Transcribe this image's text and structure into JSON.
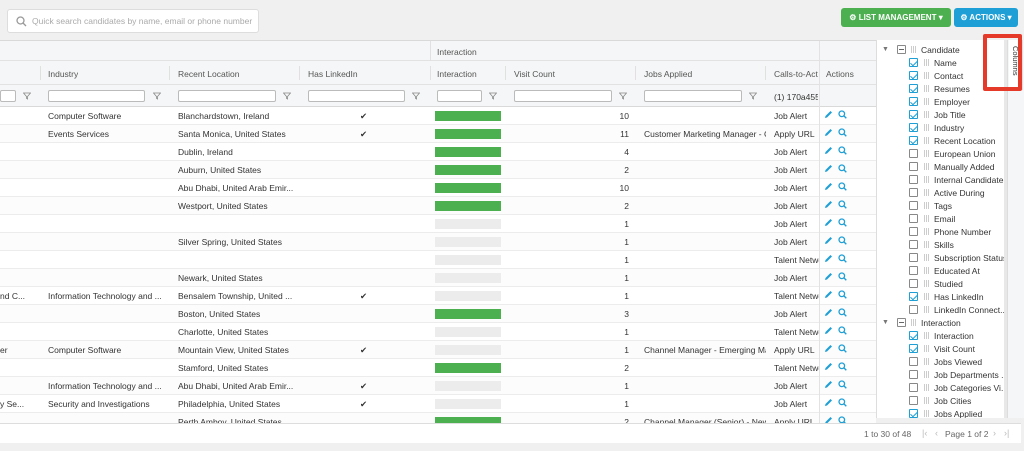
{
  "search": {
    "placeholder": "Quick search candidates by name, email or phone number"
  },
  "buttons": {
    "list_management": "LIST MANAGEMENT",
    "actions": "ACTIONS"
  },
  "colors": {
    "green": "#4caf50",
    "blue": "#1e9fd6",
    "highlight": "#e53a2a"
  },
  "grid": {
    "group_header": "Interaction",
    "headers": {
      "industry": "Industry",
      "recent_location": "Recent Location",
      "has_linkedin": "Has LinkedIn",
      "interaction": "Interaction",
      "visit_count": "Visit Count",
      "jobs_applied": "Jobs Applied",
      "calls_to_action": "Calls-to-Act",
      "actions": "Actions"
    },
    "filter_cta_text": "(1) 170a455",
    "rows": [
      {
        "first": "",
        "industry": "Computer Software",
        "location": "Blanchardstown, Ireland",
        "linkedin": "✔",
        "interaction": 1,
        "visits": "10",
        "jobs": "",
        "cta": "Job Alert"
      },
      {
        "first": "",
        "industry": "Events Services",
        "location": "Santa Monica, United States",
        "linkedin": "✔",
        "interaction": 1,
        "visits": "11",
        "jobs": "Customer Marketing Manager - C",
        "cta": "Apply URL"
      },
      {
        "first": "",
        "industry": "",
        "location": "Dublin, Ireland",
        "linkedin": "",
        "interaction": 1,
        "visits": "4",
        "jobs": "",
        "cta": "Job Alert"
      },
      {
        "first": "",
        "industry": "",
        "location": "Auburn, United States",
        "linkedin": "",
        "interaction": 1,
        "visits": "2",
        "jobs": "",
        "cta": "Job Alert"
      },
      {
        "first": "",
        "industry": "",
        "location": "Abu Dhabi, United Arab Emir...",
        "linkedin": "",
        "interaction": 1,
        "visits": "10",
        "jobs": "",
        "cta": "Job Alert"
      },
      {
        "first": "",
        "industry": "",
        "location": "Westport, United States",
        "linkedin": "",
        "interaction": 1,
        "visits": "2",
        "jobs": "",
        "cta": "Job Alert"
      },
      {
        "first": "",
        "industry": "",
        "location": "",
        "linkedin": "",
        "interaction": 0,
        "visits": "1",
        "jobs": "",
        "cta": "Job Alert"
      },
      {
        "first": "",
        "industry": "",
        "location": "Silver Spring, United States",
        "linkedin": "",
        "interaction": 0,
        "visits": "1",
        "jobs": "",
        "cta": "Job Alert"
      },
      {
        "first": "",
        "industry": "",
        "location": "",
        "linkedin": "",
        "interaction": 0,
        "visits": "1",
        "jobs": "",
        "cta": "Talent Netwo"
      },
      {
        "first": "",
        "industry": "",
        "location": "Newark, United States",
        "linkedin": "",
        "interaction": 0,
        "visits": "1",
        "jobs": "",
        "cta": "Job Alert"
      },
      {
        "first": "nd C...",
        "industry": "Information Technology and ...",
        "location": "Bensalem Township, United ...",
        "linkedin": "✔",
        "interaction": 0,
        "visits": "1",
        "jobs": "",
        "cta": "Talent Netwo"
      },
      {
        "first": "",
        "industry": "",
        "location": "Boston, United States",
        "linkedin": "",
        "interaction": 1,
        "visits": "3",
        "jobs": "",
        "cta": "Job Alert"
      },
      {
        "first": "",
        "industry": "",
        "location": "Charlotte, United States",
        "linkedin": "",
        "interaction": 0,
        "visits": "1",
        "jobs": "",
        "cta": "Talent Netwo"
      },
      {
        "first": "er",
        "industry": "Computer Software",
        "location": "Mountain View, United States",
        "linkedin": "✔",
        "interaction": 0,
        "visits": "1",
        "jobs": "Channel Manager - Emerging Ma",
        "cta": "Apply URL"
      },
      {
        "first": "",
        "industry": "",
        "location": "Stamford, United States",
        "linkedin": "",
        "interaction": 1,
        "visits": "2",
        "jobs": "",
        "cta": "Talent Netwo"
      },
      {
        "first": "",
        "industry": "Information Technology and ...",
        "location": "Abu Dhabi, United Arab Emir...",
        "linkedin": "✔",
        "interaction": 0,
        "visits": "1",
        "jobs": "",
        "cta": "Job Alert"
      },
      {
        "first": "y Se...",
        "industry": "Security and Investigations",
        "location": "Philadelphia, United States",
        "linkedin": "✔",
        "interaction": 0,
        "visits": "1",
        "jobs": "",
        "cta": "Job Alert"
      },
      {
        "first": "",
        "industry": "",
        "location": "Perth Amboy, United States",
        "linkedin": "",
        "interaction": 1,
        "visits": "2",
        "jobs": "Channel Manager (Senior) - New",
        "cta": "Apply URL"
      }
    ]
  },
  "footer": {
    "range": "1 to 30 of 48",
    "page": "Page 1 of 2"
  },
  "columns_tab": "Columns",
  "column_panel": [
    {
      "type": "group",
      "label": "Candidate"
    },
    {
      "type": "item",
      "label": "Name",
      "checked": true
    },
    {
      "type": "item",
      "label": "Contact",
      "checked": true
    },
    {
      "type": "item",
      "label": "Resumes",
      "checked": true
    },
    {
      "type": "item",
      "label": "Employer",
      "checked": true
    },
    {
      "type": "item",
      "label": "Job Title",
      "checked": true
    },
    {
      "type": "item",
      "label": "Industry",
      "checked": true
    },
    {
      "type": "item",
      "label": "Recent Location",
      "checked": true
    },
    {
      "type": "item",
      "label": "European Union",
      "checked": false
    },
    {
      "type": "item",
      "label": "Manually Added",
      "checked": false
    },
    {
      "type": "item",
      "label": "Internal Candidate",
      "checked": false
    },
    {
      "type": "item",
      "label": "Active During",
      "checked": false
    },
    {
      "type": "item",
      "label": "Tags",
      "checked": false
    },
    {
      "type": "item",
      "label": "Email",
      "checked": false
    },
    {
      "type": "item",
      "label": "Phone Number",
      "checked": false
    },
    {
      "type": "item",
      "label": "Skills",
      "checked": false
    },
    {
      "type": "item",
      "label": "Subscription Status",
      "checked": false
    },
    {
      "type": "item",
      "label": "Educated At",
      "checked": false
    },
    {
      "type": "item",
      "label": "Studied",
      "checked": false
    },
    {
      "type": "item",
      "label": "Has LinkedIn",
      "checked": true
    },
    {
      "type": "item",
      "label": "LinkedIn Connect...",
      "checked": false
    },
    {
      "type": "group",
      "label": "Interaction"
    },
    {
      "type": "item",
      "label": "Interaction",
      "checked": true
    },
    {
      "type": "item",
      "label": "Visit Count",
      "checked": true
    },
    {
      "type": "item",
      "label": "Jobs Viewed",
      "checked": false
    },
    {
      "type": "item",
      "label": "Job Departments ...",
      "checked": false
    },
    {
      "type": "item",
      "label": "Job Categories Vi...",
      "checked": false
    },
    {
      "type": "item",
      "label": "Job Cities",
      "checked": false
    },
    {
      "type": "item",
      "label": "Jobs Applied",
      "checked": true
    }
  ]
}
